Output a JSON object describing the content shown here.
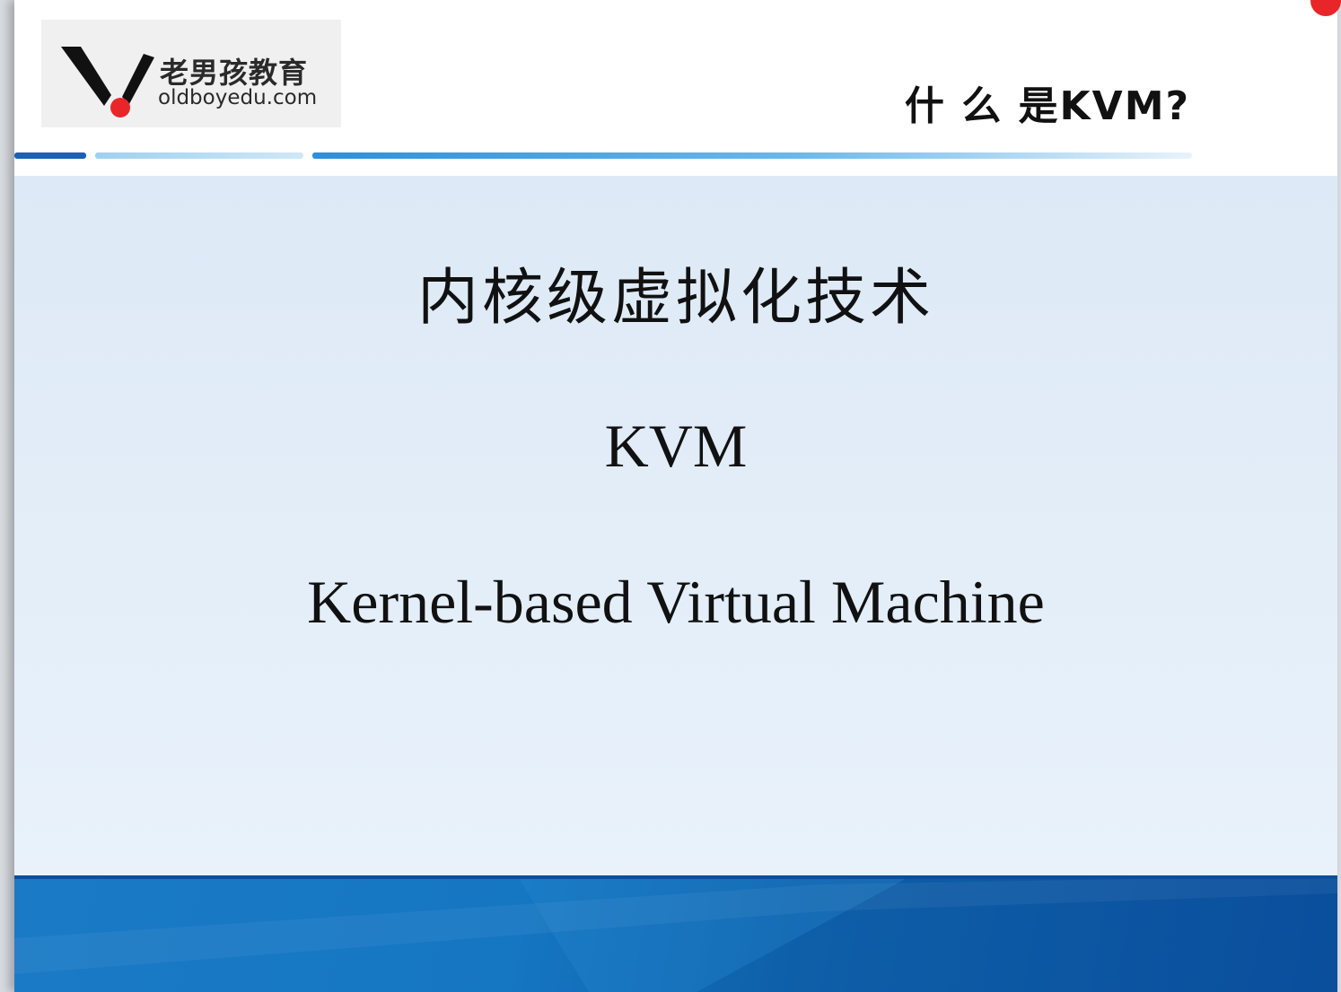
{
  "header": {
    "logo_cn": "老男孩教育",
    "logo_en": "oldboyedu.com",
    "title": "什 么 是KVM?"
  },
  "body": {
    "line1": "内核级虚拟化技术",
    "line2": "KVM",
    "line3": "Kernel-based Virtual Machine"
  },
  "colors": {
    "accent_blue": "#1576c2",
    "logo_red": "#e8262a",
    "content_bg": "#e4eef9"
  }
}
